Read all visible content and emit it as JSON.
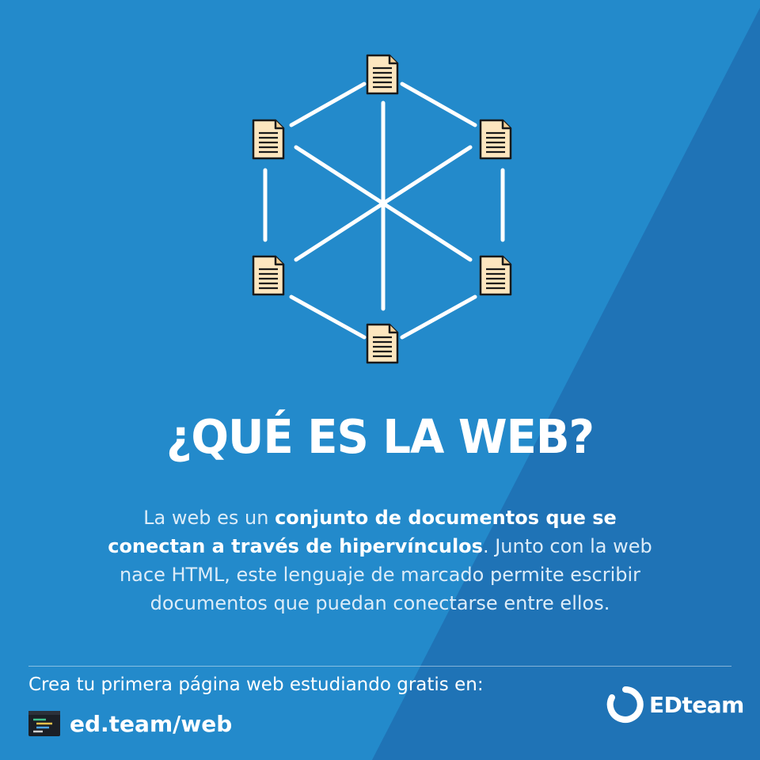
{
  "title": "¿QUÉ ES LA WEB?",
  "description": {
    "part1": "La web es un ",
    "bold": "conjunto de documentos que se conectan a través de hipervínculos",
    "part2": ". Junto con la web nace HTML, este lenguaje de marcado permite escribir documentos que puedan conectarse entre ellos."
  },
  "footer": {
    "cta": "Crea tu primera página web estudiando gratis en:",
    "link": "ed.team/web",
    "brand": "EDteam"
  },
  "colors": {
    "background": "#2278bd",
    "document_fill": "#fde6bf",
    "text": "#ffffff"
  },
  "icons": [
    "document-icon",
    "code-editor-icon",
    "edteam-logo-icon"
  ]
}
